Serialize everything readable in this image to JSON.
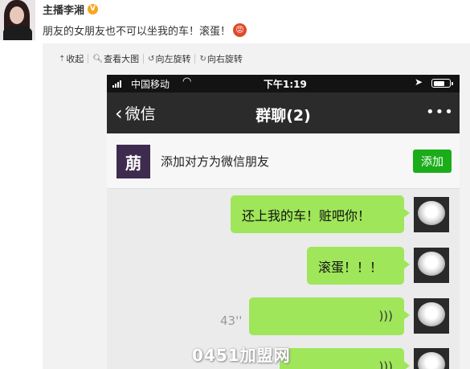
{
  "post": {
    "author": "主播李湘",
    "verified_badge": "V",
    "text": "朋友的女朋友也不可以坐我的车！滚蛋！",
    "emoji_name": "angry-face"
  },
  "toolbar": {
    "collapse": "收起",
    "view_large": "查看大图",
    "rotate_left": "向左旋转",
    "rotate_right": "向右旋转"
  },
  "phone": {
    "status_bar": {
      "carrier": "中国移动",
      "time": "下午1:19",
      "battery_level": 0.75
    },
    "nav": {
      "back_label": "微信",
      "title": "群聊(2)",
      "more": "•••"
    },
    "banner": {
      "icon_glyph": "萠",
      "text": "添加对方为微信朋友",
      "button": "添加"
    },
    "messages": [
      {
        "type": "text",
        "text": "还上我的车！赃吧你！"
      },
      {
        "type": "text",
        "text": "滚蛋！！！"
      },
      {
        "type": "voice",
        "duration": "43''"
      },
      {
        "type": "voice",
        "duration": ""
      }
    ]
  },
  "watermark": "0451加盟网",
  "colors": {
    "bubble": "#9fe65a",
    "add_button": "#1aad19",
    "nav_bar": "#2b2b2b"
  }
}
